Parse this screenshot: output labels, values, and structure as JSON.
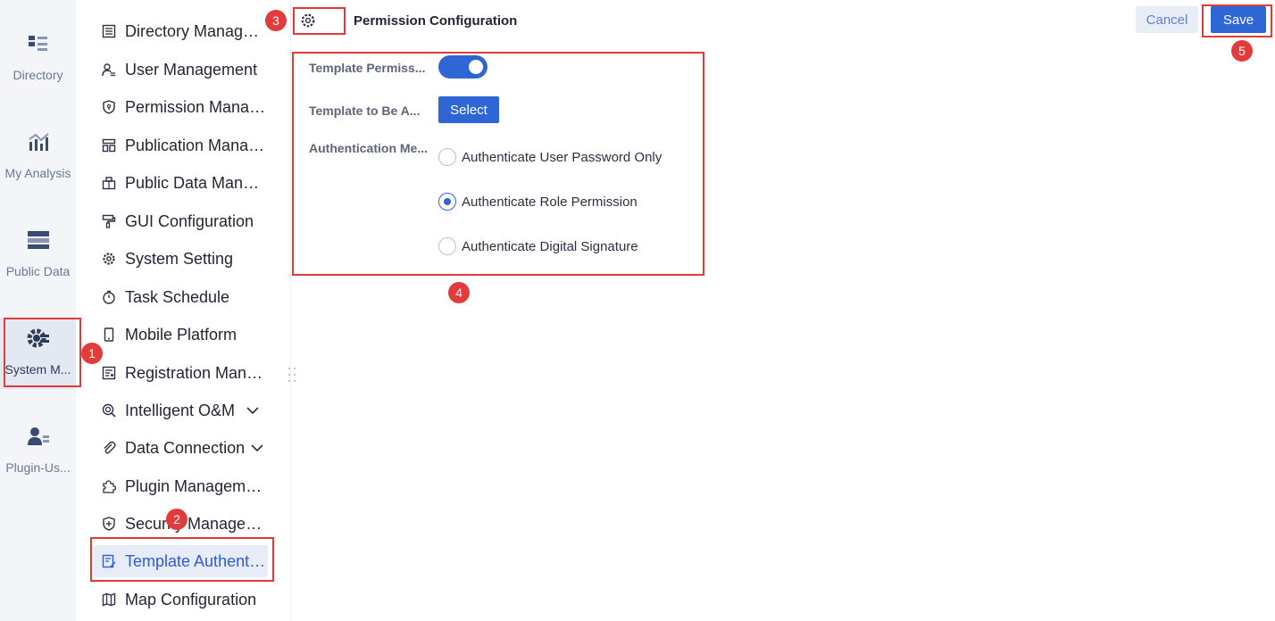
{
  "rail": {
    "items": [
      {
        "label": "Directory",
        "icon": "directory-icon"
      },
      {
        "label": "My Analysis",
        "icon": "analysis-chart-icon"
      },
      {
        "label": "Public Data",
        "icon": "public-data-icon"
      },
      {
        "label": "System M...",
        "icon": "system-management-gear-icon",
        "active": true
      },
      {
        "label": "Plugin-Us...",
        "icon": "plugin-user-icon"
      }
    ]
  },
  "menu": {
    "items": [
      {
        "label": "Directory Management",
        "icon": "list-document-icon"
      },
      {
        "label": "User Management",
        "icon": "user-list-icon"
      },
      {
        "label": "Permission Management",
        "icon": "shield-icon"
      },
      {
        "label": "Publication Management",
        "icon": "layout-icon"
      },
      {
        "label": "Public Data Management",
        "icon": "data-box-icon"
      },
      {
        "label": "GUI Configuration",
        "icon": "paint-roller-icon"
      },
      {
        "label": "System Setting",
        "icon": "gear-icon"
      },
      {
        "label": "Task Schedule",
        "icon": "stopwatch-icon"
      },
      {
        "label": "Mobile Platform",
        "icon": "mobile-phone-icon"
      },
      {
        "label": "Registration Management",
        "icon": "registration-form-icon"
      },
      {
        "label": "Intelligent O&M",
        "icon": "intelligent-om-icon",
        "expandable": true
      },
      {
        "label": "Data Connection",
        "icon": "paperclip-link-icon",
        "expandable": true
      },
      {
        "label": "Plugin Management",
        "icon": "puzzle-piece-icon"
      },
      {
        "label": "Security Management",
        "icon": "shield-plus-icon"
      },
      {
        "label": "Template Authentication",
        "icon": "template-edit-icon",
        "active": true
      },
      {
        "label": "Map Configuration",
        "icon": "map-icon"
      }
    ]
  },
  "header": {
    "title": "Permission Configuration",
    "cancel_label": "Cancel",
    "save_label": "Save"
  },
  "form": {
    "template_permission_label": "Template Permiss...",
    "template_permission_on": true,
    "template_to_be_auth_label": "Template to Be A...",
    "select_label": "Select",
    "auth_method_label": "Authentication Me...",
    "auth_options": [
      {
        "label": "Authenticate User Password Only",
        "checked": false
      },
      {
        "label": "Authenticate Role Permission",
        "checked": true
      },
      {
        "label": "Authenticate Digital Signature",
        "checked": false
      }
    ]
  },
  "annotations": [
    "1",
    "2",
    "3",
    "4",
    "5"
  ],
  "colors": {
    "accent": "#2f66d6",
    "annotation": "#e03a3a",
    "rail_bg": "#f3f5f8",
    "active_menu_bg": "#e8ecf7"
  }
}
